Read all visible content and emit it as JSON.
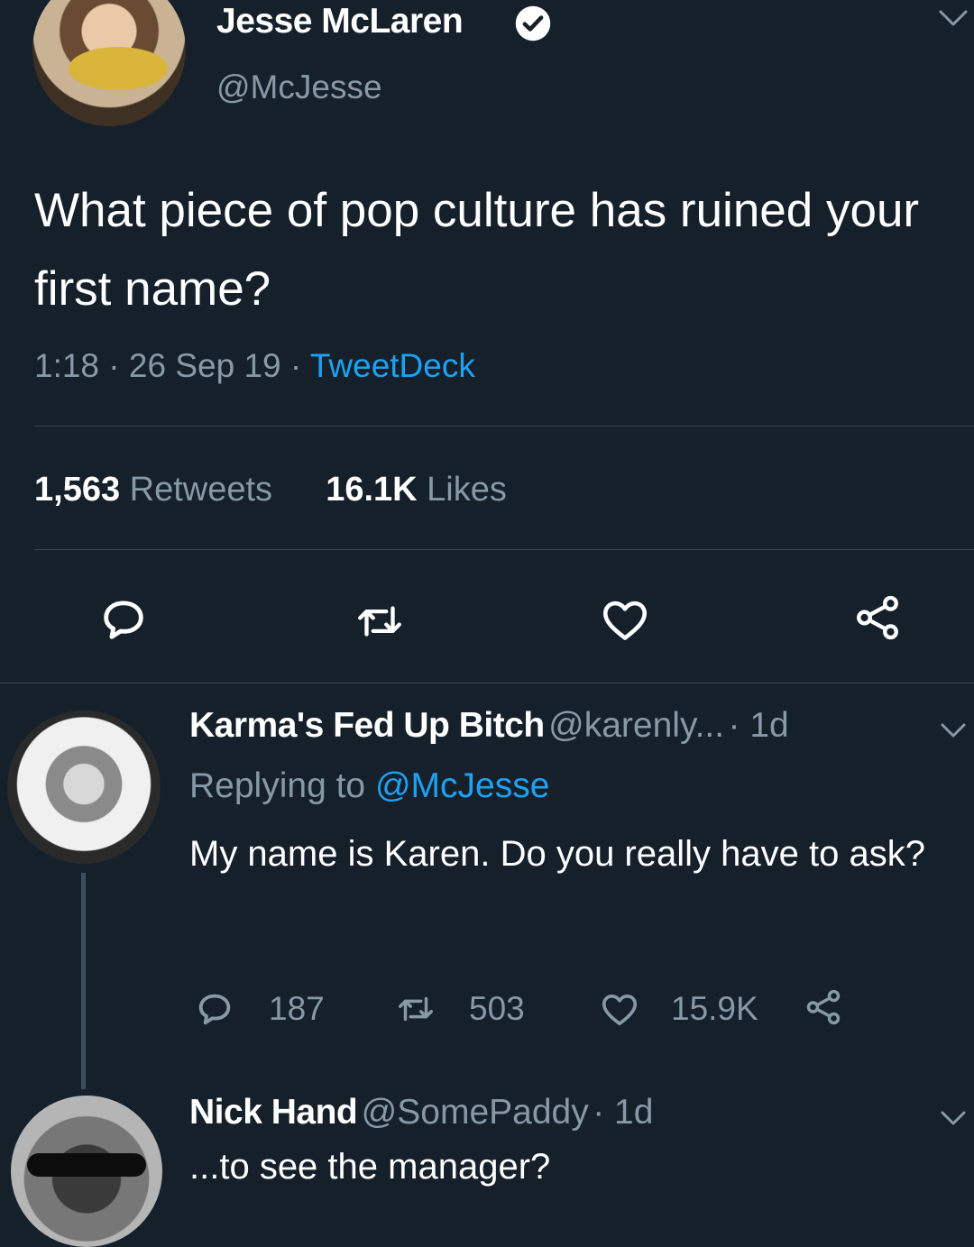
{
  "tweet": {
    "author_name": "Jesse McLaren",
    "author_handle": "@McJesse",
    "text": "What piece of pop culture has ruined your first name?",
    "time": "1:18",
    "date": "26 Sep 19",
    "separator": " · ",
    "source": "TweetDeck",
    "retweets_count": "1,563",
    "retweets_label": "Retweets",
    "likes_count": "16.1K",
    "likes_label": "Likes"
  },
  "replies": [
    {
      "name": "Karma's Fed Up Bitch",
      "handle": "@karenly...",
      "age": "· 1d",
      "replying_prefix": "Replying to",
      "replying_to": "@McJesse",
      "text": "My name is Karen. Do you really have to ask?",
      "reply_count": "187",
      "retweet_count": "503",
      "like_count": "15.9K"
    },
    {
      "name": "Nick Hand",
      "handle": "@SomePaddy",
      "age": "· 1d",
      "text": "...to see the manager?"
    }
  ],
  "colors": {
    "background": "#15202b",
    "text": "#ffffff",
    "secondary_text": "#8899a6",
    "accent": "#1da1f2",
    "divider": "#38444d"
  },
  "icons": {
    "verified": "verified-badge-icon",
    "reply": "reply-icon",
    "retweet": "retweet-icon",
    "like": "heart-icon",
    "share": "share-icon",
    "more": "chevron-down-icon"
  }
}
